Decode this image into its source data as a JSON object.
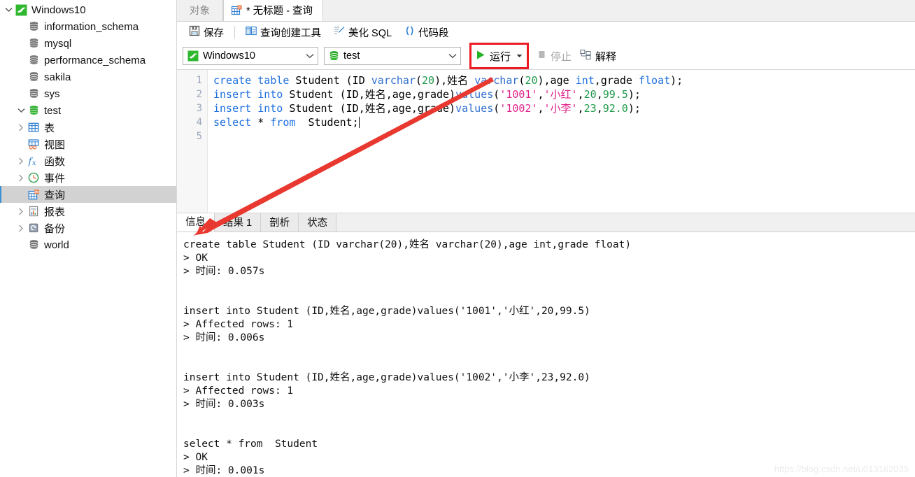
{
  "colors": {
    "accent_red": "#ed1c24",
    "mysql_green": "#27a327",
    "keyword_blue": "#1d6fe0",
    "string_magenta": "#e0218a",
    "number_green": "#1f9a4a",
    "selection_gray": "#d2d2d2",
    "arrow_red": "#e8382f"
  },
  "sidebar": {
    "items": [
      {
        "label": "Windows10",
        "icon": "mysql-dolphin-icon",
        "indent": 0,
        "twisty": "down",
        "selected": false
      },
      {
        "label": "information_schema",
        "icon": "database-icon-gray",
        "indent": 1,
        "twisty": "none",
        "selected": false
      },
      {
        "label": "mysql",
        "icon": "database-icon-gray",
        "indent": 1,
        "twisty": "none",
        "selected": false
      },
      {
        "label": "performance_schema",
        "icon": "database-icon-gray",
        "indent": 1,
        "twisty": "none",
        "selected": false
      },
      {
        "label": "sakila",
        "icon": "database-icon-gray",
        "indent": 1,
        "twisty": "none",
        "selected": false
      },
      {
        "label": "sys",
        "icon": "database-icon-gray",
        "indent": 1,
        "twisty": "none",
        "selected": false
      },
      {
        "label": "test",
        "icon": "database-icon-green",
        "indent": 1,
        "twisty": "down",
        "selected": false
      },
      {
        "label": "表",
        "icon": "table-icon",
        "indent": 2,
        "twisty": "right",
        "selected": false
      },
      {
        "label": "视图",
        "icon": "view-icon",
        "indent": 2,
        "twisty": "none",
        "selected": false
      },
      {
        "label": "函数",
        "icon": "function-fx-icon",
        "indent": 2,
        "twisty": "right",
        "selected": false
      },
      {
        "label": "事件",
        "icon": "clock-event-icon",
        "indent": 2,
        "twisty": "right",
        "selected": false
      },
      {
        "label": "查询",
        "icon": "query-icon",
        "indent": 2,
        "twisty": "none",
        "selected": true
      },
      {
        "label": "报表",
        "icon": "report-icon",
        "indent": 2,
        "twisty": "right",
        "selected": false
      },
      {
        "label": "备份",
        "icon": "backup-icon",
        "indent": 2,
        "twisty": "right",
        "selected": false
      },
      {
        "label": "world",
        "icon": "database-icon-gray",
        "indent": 1,
        "twisty": "none",
        "selected": false
      }
    ]
  },
  "window_tabs": [
    {
      "label": "对象",
      "icon": "none",
      "active": false
    },
    {
      "label": "* 无标题 - 查询",
      "icon": "query-icon",
      "active": true
    }
  ],
  "toolbar": {
    "save_label": "保存",
    "save_icon": "save-disk-icon",
    "query_builder_label": "查询创建工具",
    "query_builder_icon": "query-builder-icon",
    "beautify_label": "美化 SQL",
    "beautify_icon": "beautify-pen-icon",
    "snippet_label": "代码段",
    "snippet_icon": "parentheses-icon"
  },
  "connection_bar": {
    "connection": {
      "value": "Windows10",
      "icon": "mysql-dolphin-icon",
      "arrow_icon": "chevron-down-icon"
    },
    "database": {
      "value": "test",
      "icon": "database-icon-green",
      "arrow_icon": "chevron-down-icon"
    },
    "run": {
      "label": "运行",
      "icon": "play-triangle-icon",
      "dropdown_icon": "caret-down-icon",
      "highlighted": true
    },
    "stop": {
      "label": "停止",
      "icon": "stop-square-icon",
      "disabled": true
    },
    "explain": {
      "label": "解释",
      "icon": "explain-icon"
    }
  },
  "editor": {
    "line_numbers": [
      "1",
      "2",
      "3",
      "4",
      "5"
    ],
    "lines": [
      [
        {
          "t": "create",
          "c": "k"
        },
        {
          "t": " ",
          "c": "pl"
        },
        {
          "t": "table",
          "c": "k"
        },
        {
          "t": " Student (ID ",
          "c": "pl"
        },
        {
          "t": "varchar",
          "c": "fn"
        },
        {
          "t": "(",
          "c": "pl"
        },
        {
          "t": "20",
          "c": "num"
        },
        {
          "t": ")",
          "c": "pl"
        },
        {
          "t": ",姓名 ",
          "c": "pl"
        },
        {
          "t": "varchar",
          "c": "fn"
        },
        {
          "t": "(",
          "c": "pl"
        },
        {
          "t": "20",
          "c": "num"
        },
        {
          "t": ")",
          "c": "pl"
        },
        {
          "t": ",age ",
          "c": "pl"
        },
        {
          "t": "int",
          "c": "k"
        },
        {
          "t": ",grade ",
          "c": "pl"
        },
        {
          "t": "float",
          "c": "k"
        },
        {
          "t": ");",
          "c": "pl"
        }
      ],
      [
        {
          "t": "insert",
          "c": "k"
        },
        {
          "t": " ",
          "c": "pl"
        },
        {
          "t": "into",
          "c": "k"
        },
        {
          "t": " Student (ID,姓名,age,grade)",
          "c": "pl"
        },
        {
          "t": "values",
          "c": "fn"
        },
        {
          "t": "(",
          "c": "pl"
        },
        {
          "t": "'1001'",
          "c": "str"
        },
        {
          "t": ",",
          "c": "pl"
        },
        {
          "t": "'小红'",
          "c": "str"
        },
        {
          "t": ",",
          "c": "pl"
        },
        {
          "t": "20",
          "c": "num"
        },
        {
          "t": ",",
          "c": "pl"
        },
        {
          "t": "99.5",
          "c": "num"
        },
        {
          "t": ");",
          "c": "pl"
        }
      ],
      [
        {
          "t": "insert",
          "c": "k"
        },
        {
          "t": " ",
          "c": "pl"
        },
        {
          "t": "into",
          "c": "k"
        },
        {
          "t": " Student (ID,姓名,age,grade)",
          "c": "pl"
        },
        {
          "t": "values",
          "c": "fn"
        },
        {
          "t": "(",
          "c": "pl"
        },
        {
          "t": "'1002'",
          "c": "str"
        },
        {
          "t": ",",
          "c": "pl"
        },
        {
          "t": "'小李'",
          "c": "str"
        },
        {
          "t": ",",
          "c": "pl"
        },
        {
          "t": "23",
          "c": "num"
        },
        {
          "t": ",",
          "c": "pl"
        },
        {
          "t": "92.0",
          "c": "num"
        },
        {
          "t": ");",
          "c": "pl"
        }
      ],
      [
        {
          "t": "select",
          "c": "k"
        },
        {
          "t": " * ",
          "c": "pl"
        },
        {
          "t": "from",
          "c": "k"
        },
        {
          "t": "  Student;",
          "c": "pl"
        }
      ],
      []
    ],
    "code_text": "create table Student (ID varchar(20),姓名 varchar(20),age int,grade float);\ninsert into Student (ID,姓名,age,grade)values('1001','小红',20,99.5);\ninsert into Student (ID,姓名,age,grade)values('1002','小李',23,92.0);\nselect * from  Student;"
  },
  "result_tabs": [
    {
      "label": "信息",
      "active": true
    },
    {
      "label": "结果 1",
      "active": false
    },
    {
      "label": "剖析",
      "active": false
    },
    {
      "label": "状态",
      "active": false
    }
  ],
  "log": {
    "text": "create table Student (ID varchar(20),姓名 varchar(20),age int,grade float)\n> OK\n> 时间: 0.057s\n\n\ninsert into Student (ID,姓名,age,grade)values('1001','小红',20,99.5)\n> Affected rows: 1\n> 时间: 0.006s\n\n\ninsert into Student (ID,姓名,age,grade)values('1002','小李',23,92.0)\n> Affected rows: 1\n> 时间: 0.003s\n\n\nselect * from  Student\n> OK\n> 时间: 0.001s"
  },
  "watermark": {
    "text": "https://blog.csdn.net/u013162035"
  }
}
